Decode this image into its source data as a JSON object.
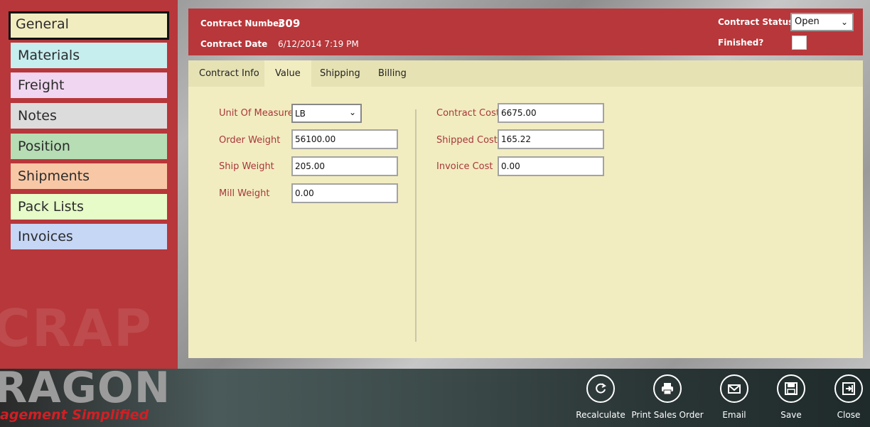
{
  "sidebar": {
    "items": [
      {
        "label": "General",
        "color": "#f2edc1",
        "active": true
      },
      {
        "label": "Materials",
        "color": "#c6eeef"
      },
      {
        "label": "Freight",
        "color": "#f0d6f0"
      },
      {
        "label": "Notes",
        "color": "#dcdcdc"
      },
      {
        "label": "Position",
        "color": "#b6ddb4"
      },
      {
        "label": "Shipments",
        "color": "#f8c8a6"
      },
      {
        "label": "Pack Lists",
        "color": "#e6fbc8"
      },
      {
        "label": "Invoices",
        "color": "#c6d6f5"
      }
    ],
    "watermark": "CRAP"
  },
  "header": {
    "contract_number_label": "Contract Number",
    "contract_number": "309",
    "contract_date_label": "Contract Date",
    "contract_date": "6/12/2014 7:19 PM",
    "status_label": "Contract Status",
    "status_value": "Open",
    "finished_label": "Finished?"
  },
  "tabs": [
    {
      "label": "Contract Info"
    },
    {
      "label": "Value",
      "active": true
    },
    {
      "label": "Shipping"
    },
    {
      "label": "Billing"
    }
  ],
  "value_tab": {
    "uom_label": "Unit Of Measure",
    "uom_value": "LB",
    "order_weight_label": "Order Weight",
    "order_weight": "56100.00",
    "ship_weight_label": "Ship Weight",
    "ship_weight": "205.00",
    "mill_weight_label": "Mill Weight",
    "mill_weight": "0.00",
    "contract_cost_label": "Contract Cost",
    "contract_cost": "6675.00",
    "shipped_cost_label": "Shipped Cost",
    "shipped_cost": "165.22",
    "invoice_cost_label": "Invoice Cost",
    "invoice_cost": "0.00"
  },
  "appbar": {
    "brand_title": "RAGON",
    "brand_tagline": "agement Simplified",
    "buttons": [
      {
        "label": "Recalculate",
        "icon": "refresh-icon"
      },
      {
        "label": "Print Sales Order",
        "icon": "printer-icon"
      },
      {
        "label": "Email",
        "icon": "mail-icon"
      },
      {
        "label": "Save",
        "icon": "save-icon"
      },
      {
        "label": "Close",
        "icon": "exit-icon"
      }
    ]
  },
  "colors": {
    "brand_red": "#b7373a",
    "content_bg": "#f2edc1",
    "label_red": "#a8373a"
  }
}
